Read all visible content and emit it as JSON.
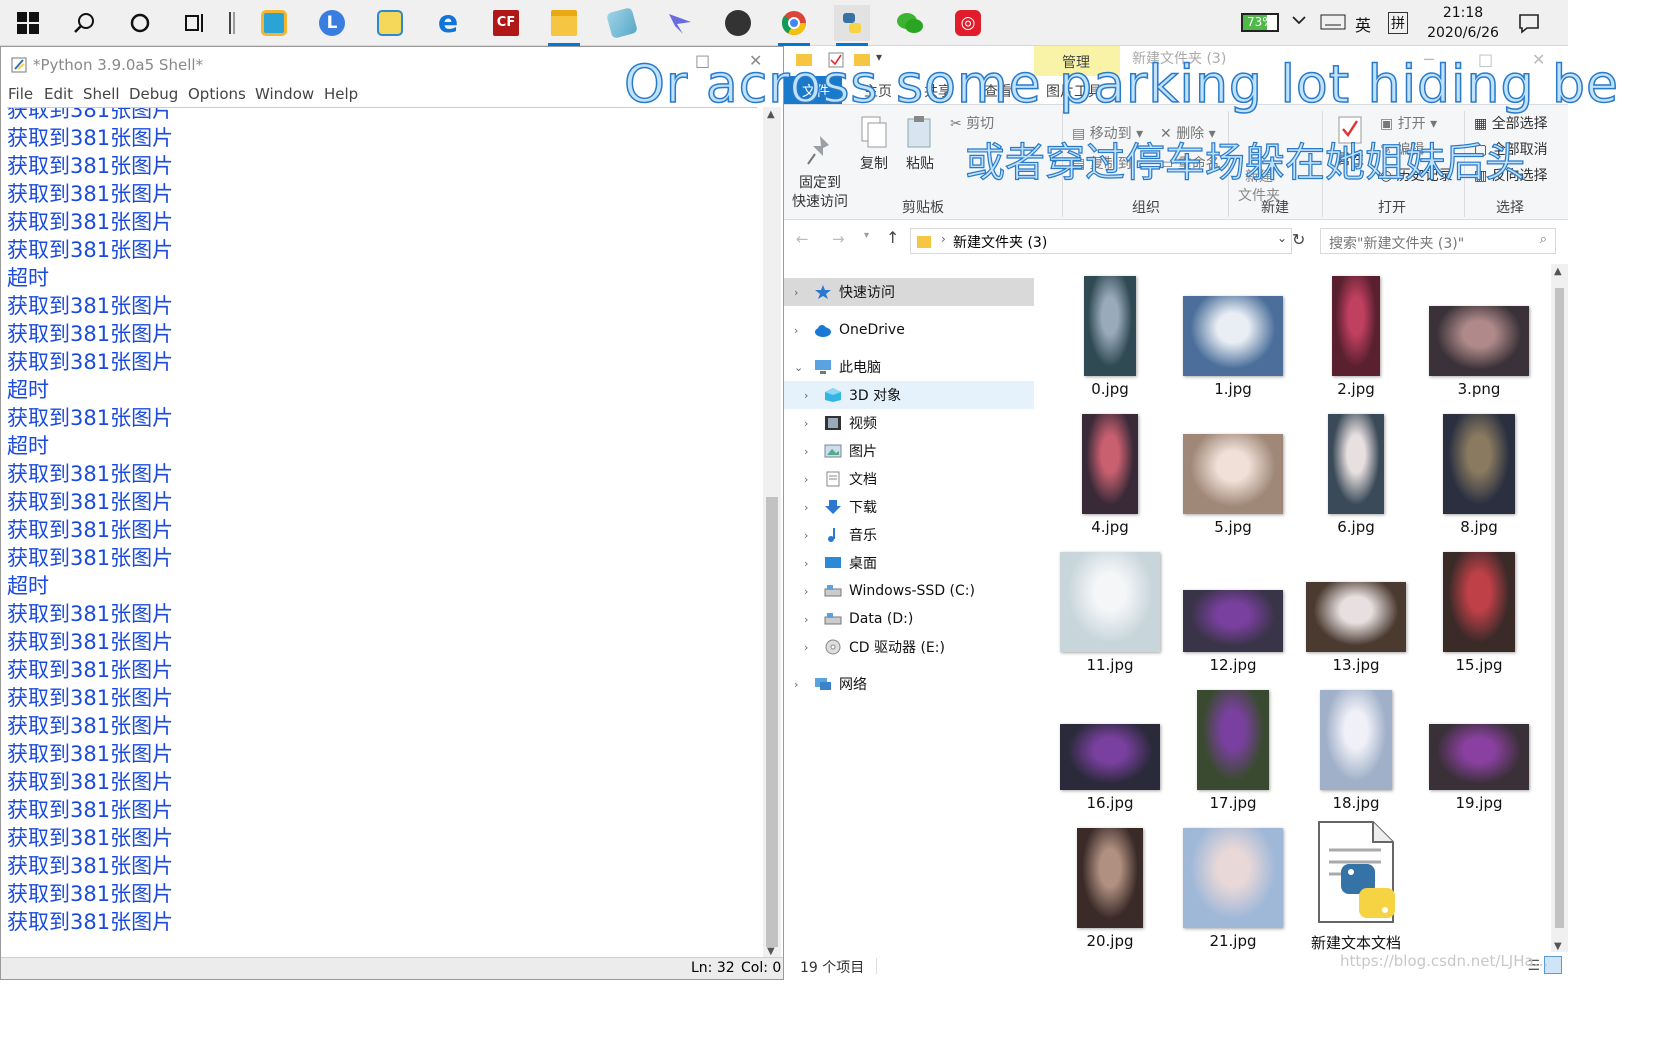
{
  "taskbar": {
    "battery": "73%",
    "ime_lang": "英",
    "ime_mode": "拼",
    "time": "21:18",
    "date": "2020/6/26",
    "apps": [
      "start-icon",
      "search-icon",
      "cortana-icon",
      "task-view-icon",
      "app-icon-1",
      "app-icon-l",
      "screenshot-icon",
      "edge-icon",
      "cf-icon",
      "file-explorer-icon",
      "notes-icon",
      "bird-icon",
      "mountain-icon",
      "chrome-icon",
      "python-icon",
      "wechat-icon",
      "netease-music-icon"
    ]
  },
  "python_shell": {
    "title": "*Python 3.9.0a5 Shell*",
    "menu": [
      "File",
      "Edit",
      "Shell",
      "Debug",
      "Options",
      "Window",
      "Help"
    ],
    "output": [
      "获取到381张图片",
      "获取到381张图片",
      "获取到381张图片",
      "获取到381张图片",
      "获取到381张图片",
      "获取到381张图片",
      "超时",
      "获取到381张图片",
      "获取到381张图片",
      "获取到381张图片",
      "超时",
      "获取到381张图片",
      "超时",
      "获取到381张图片",
      "获取到381张图片",
      "获取到381张图片",
      "获取到381张图片",
      "超时",
      "获取到381张图片",
      "获取到381张图片",
      "获取到381张图片",
      "获取到381张图片",
      "获取到381张图片",
      "获取到381张图片",
      "获取到381张图片",
      "获取到381张图片",
      "获取到381张图片",
      "获取到381张图片",
      "获取到381张图片",
      "获取到381张图片"
    ],
    "status_ln": "Ln: 32",
    "status_col": "Col: 0"
  },
  "explorer": {
    "manage_tab": "管理",
    "title": "新建文件夹 (3)",
    "tabs": [
      "文件",
      "主页",
      "共享",
      "查看",
      "图片工具"
    ],
    "ribbon": {
      "pin": "固定到\n快速访问",
      "copy": "复制",
      "paste": "粘贴",
      "cut": "剪切",
      "move_to": "移动到",
      "delete": "删除",
      "rename": "重命名",
      "copy_to": "复制到",
      "new_folder": "新建\n文件夹",
      "properties": "属性",
      "open": "打开",
      "edit": "编辑",
      "history": "历史记录",
      "select_all": "全部选择",
      "select_none": "全部取消",
      "invert": "反向选择",
      "groups": [
        "剪贴板",
        "组织",
        "新建",
        "打开",
        "选择"
      ]
    },
    "address": "新建文件夹 (3)",
    "search_placeholder": "搜索\"新建文件夹 (3)\"",
    "nav": [
      "快速访问",
      "OneDrive",
      "此电脑",
      "3D 对象",
      "视频",
      "图片",
      "文档",
      "下载",
      "音乐",
      "桌面",
      "Windows-SSD (C:)",
      "Data (D:)",
      "CD 驱动器 (E:)",
      "网络"
    ],
    "files": [
      "0.jpg",
      "1.jpg",
      "2.jpg",
      "3.png",
      "4.jpg",
      "5.jpg",
      "6.jpg",
      "8.jpg",
      "11.jpg",
      "12.jpg",
      "13.jpg",
      "15.jpg",
      "16.jpg",
      "17.jpg",
      "18.jpg",
      "19.jpg",
      "20.jpg",
      "21.jpg",
      "新建文本文档"
    ],
    "status": "19 个项目"
  },
  "overlay": {
    "subtitle_en": "Or across some parking lot hiding be",
    "subtitle_zh": "或者穿过停车场躲在她姐妹后头",
    "watermark": "https://blog.csdn.net/LJHa..."
  }
}
